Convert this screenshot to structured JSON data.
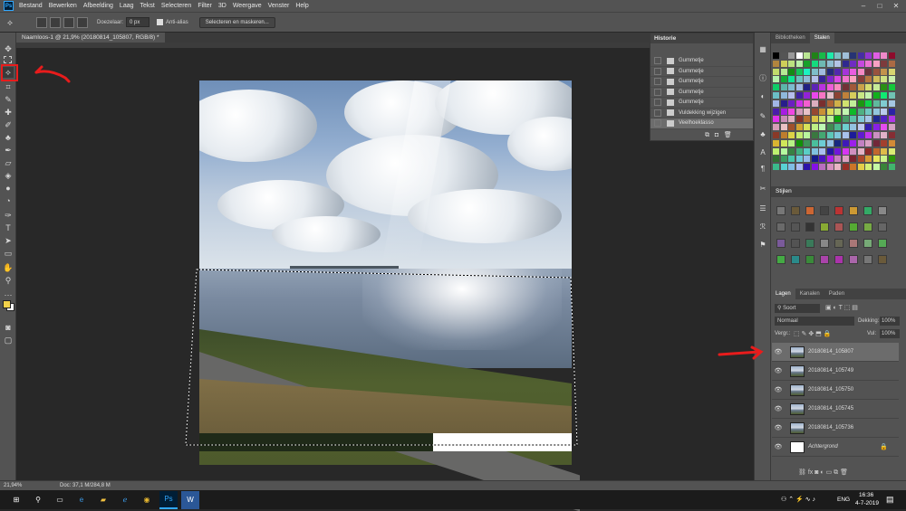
{
  "menubar": {
    "app_logo": "Ps",
    "items": [
      "Bestand",
      "Bewerken",
      "Afbeelding",
      "Laag",
      "Tekst",
      "Selecteren",
      "Filter",
      "3D",
      "Weergave",
      "Venster",
      "Help"
    ],
    "minimize_icon": "–",
    "maximize_icon": "□",
    "close_icon": "✕"
  },
  "options": {
    "feather_label": "Doezelaar:",
    "feather_value": "0 px",
    "antialias_label": "Anti-alias",
    "select_mask_button": "Selecteren en maskeren..."
  },
  "document": {
    "tab_title": "Naamloos-1 @ 21,9% (20180814_105807, RGB/8) *"
  },
  "history": {
    "title": "Historie",
    "items": [
      {
        "label": "Gummetje"
      },
      {
        "label": "Gummetje"
      },
      {
        "label": "Gummetje"
      },
      {
        "label": "Gummetje"
      },
      {
        "label": "Gummetje"
      },
      {
        "label": "Vuldekking wijzigen"
      },
      {
        "label": "Veelhoeklasso"
      }
    ]
  },
  "swatches_panel": {
    "tabs": [
      "Bibliotheken",
      "Stalen"
    ],
    "active_tab": "Stalen"
  },
  "styles_panel": {
    "title": "Stijlen"
  },
  "layers_panel": {
    "tabs": [
      "Lagen",
      "Kanalen",
      "Paden"
    ],
    "filter_label": "Soort",
    "blend_mode": "Normaal",
    "opacity_label": "Dekking:",
    "opacity_value": "100%",
    "lock_label": "Vergr.:",
    "fill_label": "Vul:",
    "fill_value": "100%",
    "layers": [
      {
        "name": "20180814_105807",
        "active": true
      },
      {
        "name": "20180814_105749",
        "active": false
      },
      {
        "name": "20180814_105750",
        "active": false
      },
      {
        "name": "20180814_105745",
        "active": false
      },
      {
        "name": "20180814_105736",
        "active": false
      },
      {
        "name": "Achtergrond",
        "active": false
      }
    ]
  },
  "status": {
    "zoom": "21,94%",
    "doc_size": "Doc: 37,1 M/284,8 M"
  },
  "taskbar": {
    "language": "ENG",
    "time": "16:36",
    "date": "4-7-2019"
  },
  "colors": {
    "foreground_swatch": "#f3d24a",
    "background_swatch": "#ffffff",
    "annotation_arrow": "#e81c1c"
  }
}
